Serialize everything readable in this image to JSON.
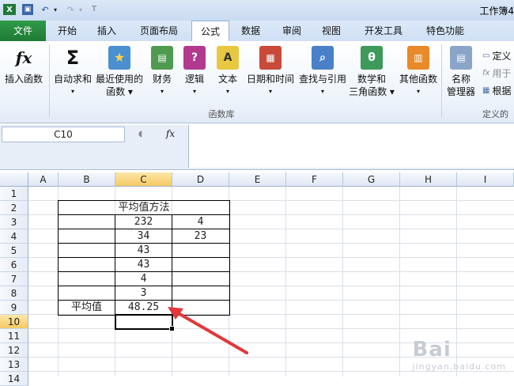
{
  "window": {
    "title": "工作簿4"
  },
  "ribbon_tabs": [
    "文件",
    "开始",
    "插入",
    "页面布局",
    "公式",
    "数据",
    "审阅",
    "视图",
    "开发工具",
    "特色功能"
  ],
  "ribbon": {
    "insert_function": "插入函数",
    "autosum": "自动求和",
    "recent": [
      "最近使用的",
      "函数 ▾"
    ],
    "finance": "财务",
    "logic": "逻辑",
    "text": "文本",
    "datetime": "日期和时间",
    "lookup": "查找与引用",
    "math": [
      "数学和",
      "三角函数 ▾"
    ],
    "other": "其他函数",
    "name_manager": [
      "名称",
      "管理器"
    ],
    "group_label": "函数库",
    "define_name": "定义",
    "use_in_formula": "用于",
    "create_from_selection": "根据",
    "defined_group_label": "定义的"
  },
  "formula_bar": {
    "name_box": "C10",
    "fx_label": "fx"
  },
  "columns": [
    "A",
    "B",
    "C",
    "D",
    "E",
    "F",
    "G",
    "H",
    "I"
  ],
  "rows": [
    "1",
    "2",
    "3",
    "4",
    "5",
    "6",
    "7",
    "8",
    "9",
    "10",
    "11",
    "12",
    "13",
    "14"
  ],
  "cells": {
    "title": "平均值方法",
    "c_values": [
      "232",
      "34",
      "43",
      "43",
      "4",
      "3"
    ],
    "d_values": [
      "4",
      "23"
    ],
    "avg_label": "平均值",
    "avg_value": "48.25"
  },
  "watermark": {
    "text": "Bai",
    "sub": "jingyan.baidu.com"
  },
  "colors": {
    "file_tab": "#2f9a48",
    "selection_header": "#f6c964",
    "arrow": "#e0383a"
  }
}
